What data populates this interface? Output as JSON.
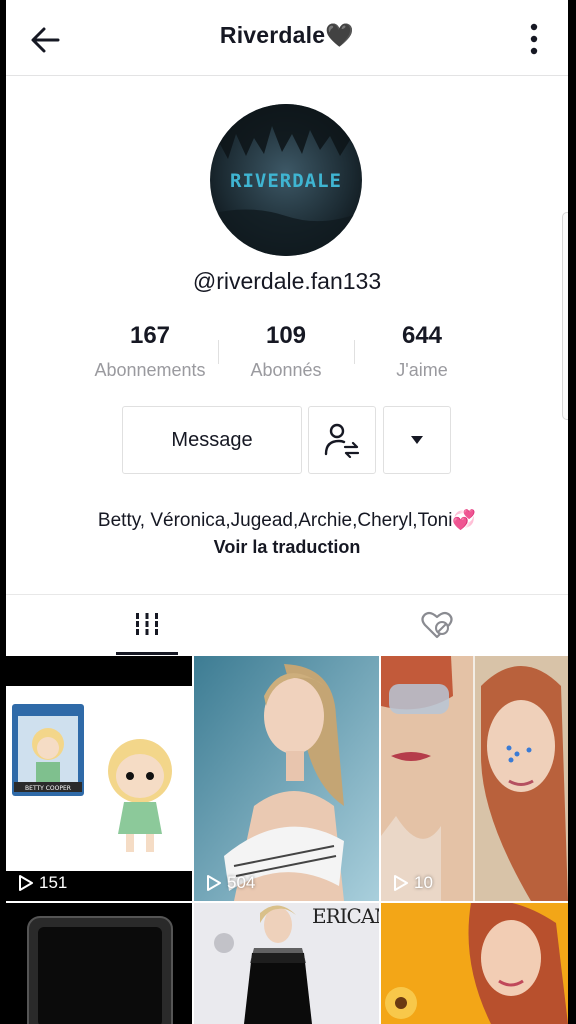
{
  "header": {
    "title": "Riverdale🖤",
    "back_icon": "arrow-left-icon",
    "more_icon": "more-vertical-icon"
  },
  "profile": {
    "avatar_text": "RIVERDALE",
    "username": "@riverdale.fan133",
    "stats": [
      {
        "value": "167",
        "label": "Abonnements"
      },
      {
        "value": "109",
        "label": "Abonnés"
      },
      {
        "value": "644",
        "label": "J'aime"
      }
    ],
    "message_label": "Message",
    "follow_icon": "user-switch-icon",
    "dropdown_icon": "caret-down-icon",
    "bio": "Betty, Véronica,Jugead,Archie,Cheryl,Toni💞",
    "translate_label": "Voir la traduction"
  },
  "tabs": {
    "videos_icon": "grid-icon",
    "liked_icon": "liked-heart-icon"
  },
  "videos": [
    {
      "views": "151",
      "icon": "play-icon"
    },
    {
      "views": "504",
      "icon": "play-icon"
    },
    {
      "views": "10",
      "icon": "play-icon"
    },
    {
      "views": "",
      "icon": "play-icon"
    },
    {
      "views": "",
      "icon": "play-icon"
    },
    {
      "views": "",
      "icon": "play-icon"
    }
  ],
  "video_tiles": {
    "tile2_overlay_text": "ERICAN MUSIC RDS",
    "figure_text": "BETTY COOPER"
  }
}
